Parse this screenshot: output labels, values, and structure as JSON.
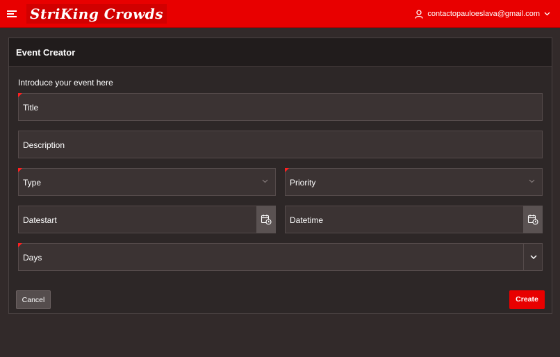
{
  "header": {
    "app_name": "StriKing Crowds",
    "user_email": "contactopauloeslava@gmail.com",
    "brand_color": "#e80000"
  },
  "form": {
    "title": "Event Creator",
    "intro": "Introduce your event here",
    "fields": {
      "title": {
        "label": "Title",
        "required": true
      },
      "description": {
        "label": "Description",
        "required": false
      },
      "type": {
        "label": "Type",
        "required": true
      },
      "priority": {
        "label": "Priority",
        "required": true
      },
      "datestart": {
        "label": "Datestart",
        "required": false
      },
      "datetime": {
        "label": "Datetime",
        "required": false
      },
      "days": {
        "label": "Days",
        "required": true
      }
    },
    "buttons": {
      "cancel": "Cancel",
      "create": "Create"
    }
  },
  "icons": {
    "menu": "hamburger-menu-icon",
    "user": "user-icon",
    "dropdown": "chevron-down-icon",
    "calendar": "calendar-clock-icon"
  }
}
